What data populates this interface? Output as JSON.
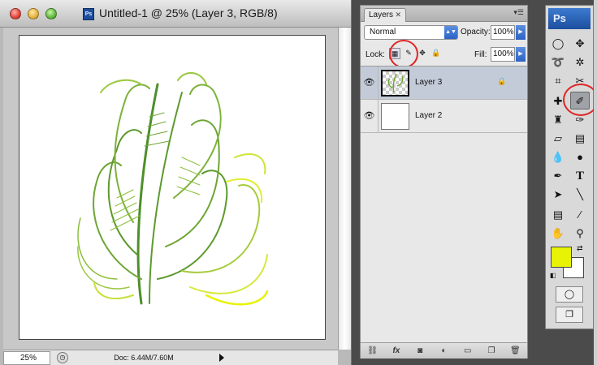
{
  "document": {
    "title": "Untitled-1 @ 25% (Layer 3, RGB/8)",
    "doc_icon": "Ps",
    "status": {
      "zoom": "25%",
      "doc_size": "Doc: 6.44M/7.60M"
    }
  },
  "layers_panel": {
    "tab_label": "Layers",
    "tab_close": "✕",
    "blend_mode": "Normal",
    "opacity_label": "Opacity:",
    "opacity_value": "100%",
    "lock_label": "Lock:",
    "fill_label": "Fill:",
    "fill_value": "100%",
    "layers": [
      {
        "name": "Layer 3",
        "selected": true,
        "locked": true
      },
      {
        "name": "Layer 2",
        "selected": false,
        "locked": false
      }
    ],
    "footer_icons": [
      "link-icon",
      "fx-icon",
      "mask-icon",
      "adjustment-icon",
      "folder-icon",
      "new-layer-icon",
      "trash-icon"
    ],
    "fx_label": "fx"
  },
  "tools_panel": {
    "logo": "Ps",
    "foreground_color": "#e8f205",
    "background_color": "#ffffff",
    "active_tool": "brush-tool",
    "type_tool_label": "T"
  },
  "annotations": {
    "highlight_color": "#e02525"
  },
  "canvas": {
    "artwork_colors": [
      "#4e8f2a",
      "#8cbf3c",
      "#e8f205"
    ]
  }
}
